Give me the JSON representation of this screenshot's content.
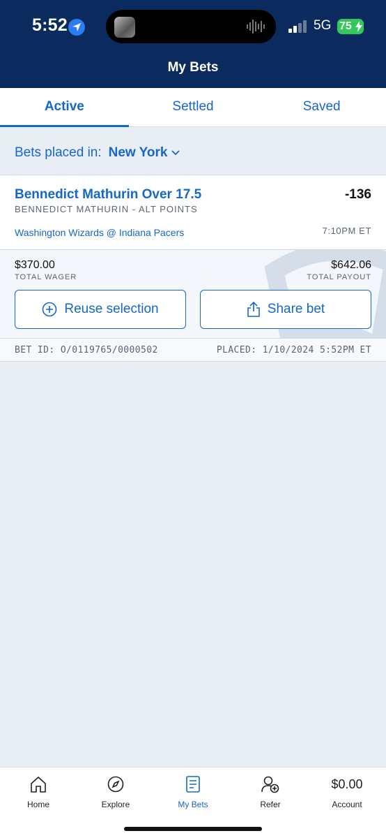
{
  "status_bar": {
    "time": "5:52",
    "network": "5G",
    "battery": "75"
  },
  "header": {
    "title": "My Bets"
  },
  "tabs": [
    {
      "label": "Active",
      "active": true
    },
    {
      "label": "Settled",
      "active": false
    },
    {
      "label": "Saved",
      "active": false
    }
  ],
  "location": {
    "prefix": "Bets placed in:",
    "state": "New York"
  },
  "bet": {
    "title": "Bennedict Mathurin Over 17.5",
    "odds": "-136",
    "market": "BENNEDICT MATHURIN - ALT POINTS",
    "game": "Washington Wizards @ Indiana Pacers",
    "game_time": "7:10PM ET",
    "wager_value": "$370.00",
    "wager_label": "TOTAL WAGER",
    "payout_value": "$642.06",
    "payout_label": "TOTAL PAYOUT",
    "reuse_label": "Reuse selection",
    "share_label": "Share bet",
    "bet_id": "BET ID: O/0119765/0000502",
    "placed": "PLACED: 1/10/2024 5:52PM ET"
  },
  "nav": {
    "home": "Home",
    "explore": "Explore",
    "mybets": "My Bets",
    "refer": "Refer",
    "account": "Account",
    "balance": "$0.00"
  },
  "colors": {
    "header_bg": "#0b2a5e",
    "accent": "#1567c9",
    "page_bg": "#e9eef5",
    "battery": "#34c759"
  }
}
